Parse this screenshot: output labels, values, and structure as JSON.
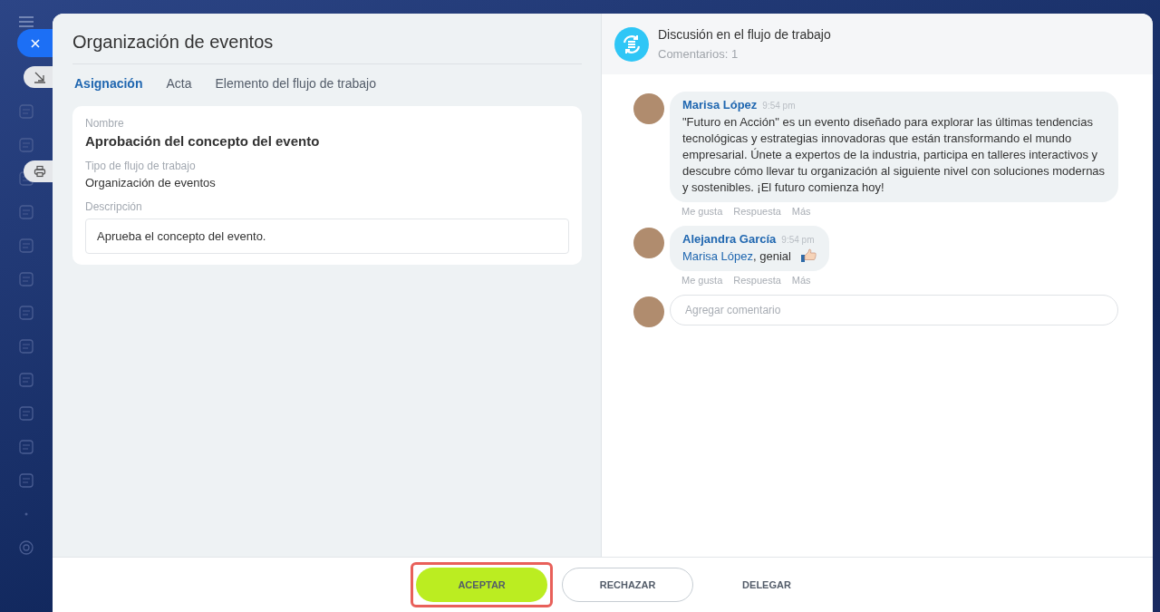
{
  "task": {
    "title": "Organización de eventos",
    "tabs": [
      {
        "label": "Asignación",
        "selected": true
      },
      {
        "label": "Acta",
        "selected": false
      },
      {
        "label": "Elemento del flujo de trabajo",
        "selected": false
      }
    ],
    "fields": [
      {
        "label": "Nombre",
        "value": "Aprobación del concepto del evento",
        "kind": "heading"
      },
      {
        "label": "Tipo de flujo de trabajo",
        "value": "Organización de eventos",
        "kind": "plain"
      },
      {
        "label": "Descripción",
        "value": "Aprueba el concepto del evento.",
        "kind": "box"
      }
    ]
  },
  "discussion": {
    "title": "Discusión en el flujo de trabajo",
    "count": "Comentarios: 1",
    "comments": [
      {
        "author": "Marisa López",
        "time": "9:54 pm",
        "text": "\"Futuro en Acción\" es un evento diseñado para explorar las últimas tendencias tecnológicas y estrategias innovadoras que están transformando el mundo empresarial. Únete a expertos de la industria, participa en talleres interactivos y descubre cómo llevar tu organización al siguiente nivel con soluciones modernas y sostenibles. ¡El futuro comienza hoy!",
        "actions": [
          "Me gusta",
          "Respuesta",
          "Más"
        ]
      },
      {
        "author": "Alejandra García",
        "time": "9:54 pm",
        "mention": "Marisa López",
        "text": ", genial",
        "like_emoji": true,
        "actions": [
          "Me gusta",
          "Respuesta",
          "Más"
        ]
      }
    ],
    "input": {
      "placeholder": "Agregar comentario"
    }
  },
  "buttons": [
    {
      "label": "ACEPTAR",
      "kind": "primary",
      "highlighted": true
    },
    {
      "label": "RECHAZAR",
      "kind": "outline",
      "highlighted": false
    },
    {
      "label": "DELEGAR",
      "kind": "text",
      "highlighted": false
    }
  ]
}
